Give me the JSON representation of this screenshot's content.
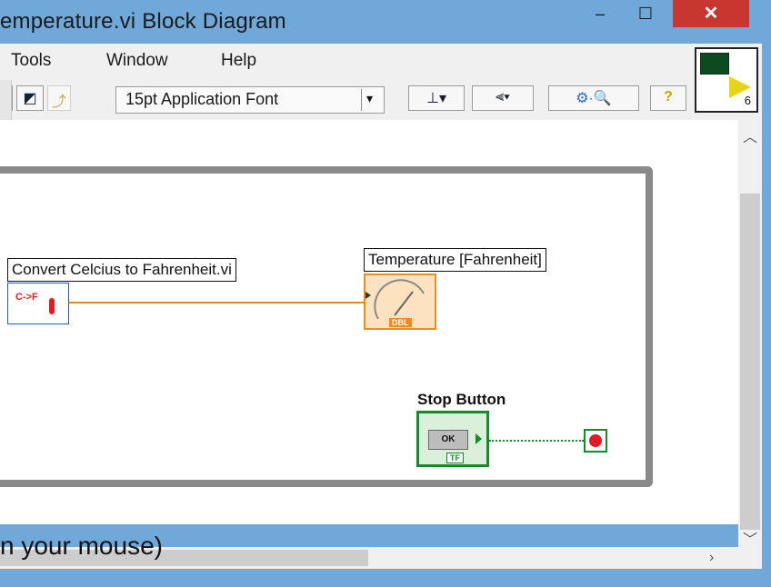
{
  "window": {
    "title": "emperature.vi Block Diagram",
    "controls": {
      "minimize": "–",
      "maximize": "☐",
      "close": "✕"
    }
  },
  "menubar": {
    "items": [
      "Tools",
      "Window",
      "Help"
    ]
  },
  "toolbar": {
    "font_selector": "15pt Application Font",
    "dropdown_arrow": "▾"
  },
  "context_icon": {
    "number": "6"
  },
  "diagram": {
    "subvi_label": "Convert Celcius to Fahrenheit.vi",
    "subvi_icon_text": "C->F",
    "indicator_label": "Temperature [Fahrenheit]",
    "indicator_type": "DBL",
    "stop_label": "Stop Button",
    "stop_button_text": "OK",
    "stop_type": "TF"
  },
  "instruction_text": "n your mouse)",
  "colors": {
    "titlebar": "#6fa8d9",
    "close": "#c7372f",
    "subvi_border": "#1f5fc7",
    "orange_wire": "#e88a1d",
    "green_wire": "#178a2b",
    "loop_border": "#8a8a8a"
  }
}
